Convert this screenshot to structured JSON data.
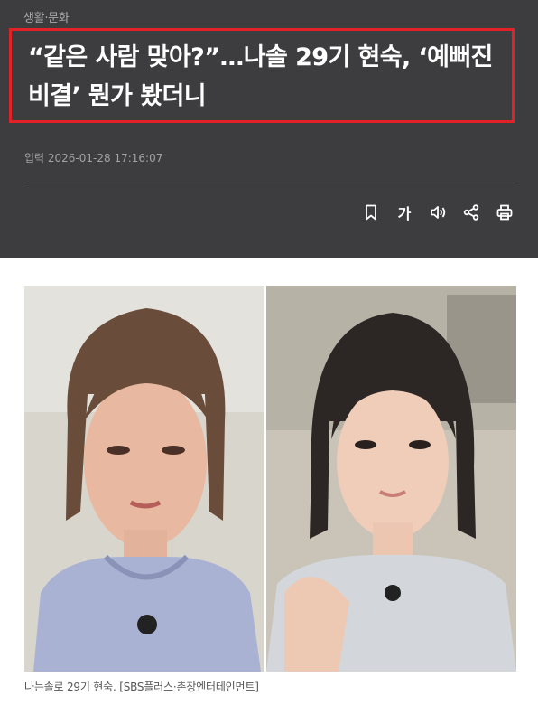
{
  "article": {
    "category": "생활·문화",
    "headline": "“같은 사람 맞아?”…나솔 29기 현숙, ‘예뻐진 비결’ 뭔가 봤더니",
    "date": "입력 2026-01-28 17:16:07"
  },
  "toolbar": {
    "font_size_label": "가",
    "icons": [
      "bookmark-icon",
      "font-size-icon",
      "speaker-icon",
      "share-icon",
      "print-icon"
    ]
  },
  "photo": {
    "caption": "나는솔로 29기 현숙. [SBS플러스·촌장엔터테인먼트]"
  },
  "colors": {
    "header_bg": "#3d3d3f",
    "highlight_border": "#e32228",
    "headline_text": "#ffffff"
  }
}
